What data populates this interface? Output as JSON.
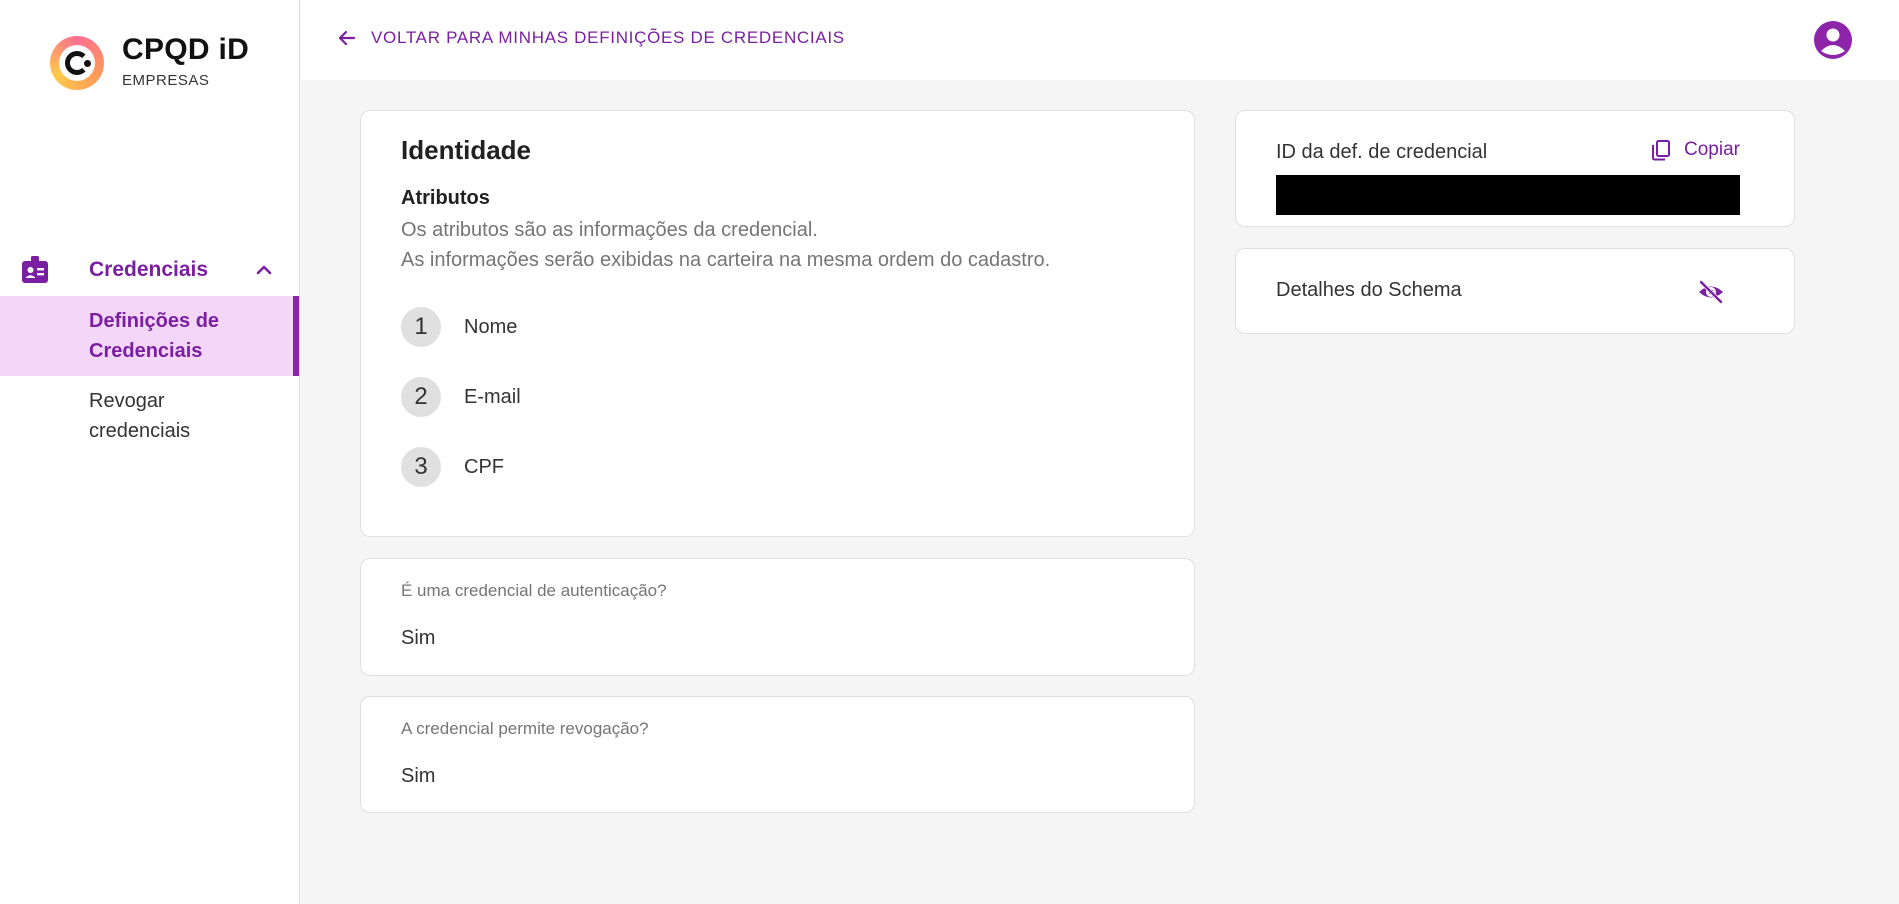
{
  "app": {
    "brand_title": "CPQD iD",
    "brand_subtitle": "EMPRESAS"
  },
  "sidebar": {
    "group_label": "Credenciais",
    "items": [
      {
        "label_line1": "Definições de",
        "label_line2": "Credenciais",
        "active": true
      },
      {
        "label_line1": "Revogar",
        "label_line2": "credenciais",
        "active": false
      }
    ]
  },
  "header": {
    "back_label": "VOLTAR PARA MINHAS DEFINIÇÕES DE CREDENCIAIS"
  },
  "credential": {
    "title": "Identidade",
    "attributes_title": "Atributos",
    "attributes_desc_line1": "Os atributos são as informações da credencial.",
    "attributes_desc_line2": "As informações serão exibidas na carteira na mesma ordem do cadastro.",
    "attributes": [
      {
        "number": "1",
        "name": "Nome"
      },
      {
        "number": "2",
        "name": "E-mail"
      },
      {
        "number": "3",
        "name": "CPF"
      }
    ],
    "auth_question": "É uma credencial de autenticação?",
    "auth_answer": "Sim",
    "revocation_question": "A credencial permite revogação?",
    "revocation_answer": "Sim"
  },
  "side_panel": {
    "id_label": "ID da def. de credencial",
    "copy_label": "Copiar",
    "schema_label": "Detalhes do Schema"
  },
  "colors": {
    "accent": "#7b1fa2",
    "active_bg": "#f3d6f8",
    "page_bg": "#f5f5f5"
  },
  "icons": {
    "brand": "cpqd-logo-icon",
    "group": "id-badge-icon",
    "chevron": "chevron-up-icon",
    "back": "arrow-left-icon",
    "avatar": "account-circle-icon",
    "copy": "copy-icon",
    "visibility": "eye-off-icon"
  }
}
